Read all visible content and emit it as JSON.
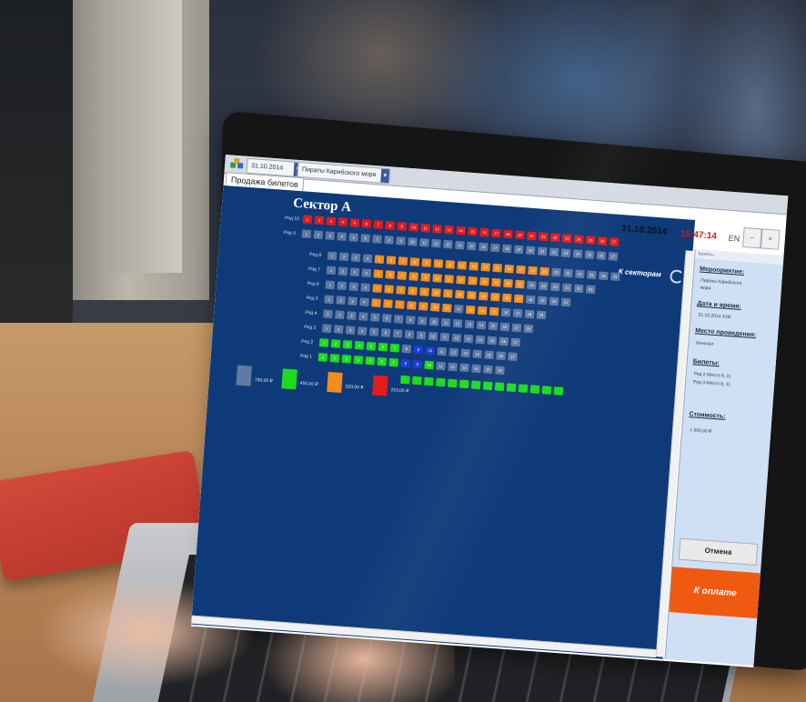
{
  "browser": {
    "date_tab": "31.10.2014",
    "event_tab": "Пираты Карибского моря",
    "page_tab": "Продажа билетов"
  },
  "header": {
    "sector_title": "Сектор А",
    "date": "31.10.2014",
    "time": "15:47:14",
    "lang": "EN"
  },
  "hall": {
    "to_sectors": "К секторам",
    "rows": [
      {
        "label": "Ряд 10",
        "seats": [
          "r",
          "r",
          "r",
          "r",
          "r",
          "r",
          "r",
          "r",
          "r",
          "r",
          "r",
          "r",
          "r",
          "r",
          "r",
          "r",
          "r",
          "r",
          "r",
          "r",
          "r",
          "r",
          "r",
          "r",
          "r",
          "r",
          "r"
        ]
      },
      {
        "label": "Ряд 9",
        "seats": [
          "g",
          "g",
          "g",
          "g",
          "g",
          "g",
          "g",
          "g",
          "g",
          "g",
          "g",
          "g",
          "g",
          "g",
          "g",
          "g",
          "g",
          "g",
          "g",
          "g",
          "g",
          "g",
          "g",
          "g",
          "g",
          "g",
          "g"
        ]
      },
      {
        "label": "Ряд 8",
        "seats": [
          "g",
          "g",
          "g",
          "g",
          "o",
          "o",
          "o",
          "o",
          "o",
          "o",
          "o",
          "o",
          "o",
          "o",
          "o",
          "o",
          "o",
          "o",
          "o",
          "g",
          "g",
          "g",
          "g",
          "g",
          "g"
        ]
      },
      {
        "label": "Ряд 7",
        "seats": [
          "g",
          "g",
          "g",
          "g",
          "o",
          "o",
          "o",
          "o",
          "o",
          "o",
          "o",
          "o",
          "o",
          "o",
          "o",
          "o",
          "o",
          "g",
          "g",
          "g",
          "g",
          "g",
          "g"
        ]
      },
      {
        "label": "Ряд 6",
        "seats": [
          "g",
          "g",
          "g",
          "g",
          "o",
          "o",
          "o",
          "o",
          "o",
          "o",
          "o",
          "o",
          "o",
          "o",
          "o",
          "o",
          "o",
          "g",
          "g",
          "g",
          "g"
        ]
      },
      {
        "label": "Ряд 5",
        "seats": [
          "g",
          "g",
          "g",
          "g",
          "o",
          "o",
          "o",
          "o",
          "o",
          "o",
          "o",
          "g",
          "o",
          "o",
          "o",
          "g",
          "g",
          "g",
          "g"
        ]
      },
      {
        "label": "Ряд 4",
        "seats": [
          "g",
          "g",
          "g",
          "g",
          "g",
          "g",
          "g",
          "g",
          "g",
          "g",
          "g",
          "g",
          "g",
          "g",
          "g",
          "g",
          "g",
          "g"
        ]
      },
      {
        "label": "Ряд 3",
        "seats": [
          "g",
          "g",
          "g",
          "g",
          "g",
          "g",
          "g",
          "g",
          "g",
          "g",
          "g",
          "g",
          "g",
          "g",
          "g",
          "g",
          "g"
        ]
      },
      {
        "label": "Ряд 2",
        "seats": [
          "G",
          "G",
          "G",
          "G",
          "G",
          "G",
          "G",
          "g",
          "b",
          "b",
          "g",
          "g",
          "g",
          "g",
          "g",
          "g",
          "g"
        ]
      },
      {
        "label": "Ряд 1",
        "seats": [
          "G",
          "G",
          "G",
          "G",
          "G",
          "G",
          "G",
          "b",
          "b",
          "G",
          "g",
          "g",
          "g",
          "g",
          "g",
          "g"
        ]
      }
    ],
    "extra_row": [
      "G",
      "G",
      "G",
      "G",
      "G",
      "G",
      "G",
      "G",
      "G",
      "G",
      "G",
      "G",
      "G",
      "G"
    ],
    "legend": [
      {
        "color": "#5f7aa2",
        "label": "760,00 ₽"
      },
      {
        "color": "#1ddc1d",
        "label": "450,00 ₽"
      },
      {
        "color": "#f48d1b",
        "label": "520,00 ₽"
      },
      {
        "color": "#e21c1c",
        "label": "210,00 ₽"
      }
    ]
  },
  "info": {
    "head": "Билеты",
    "event_label": "Мероприятие:",
    "event_value_1": "Пираты Карибского",
    "event_value_2": "моря",
    "datetime_label": "Дата и время:",
    "datetime_value": "31.10.2014 9:00",
    "place_label": "Место проведения:",
    "place_value": "Кинозал",
    "tickets_label": "Билеты:",
    "ticket_1": "Ряд 2 Место 8, 11",
    "ticket_2": "Ряд 3 Место 8, 11",
    "cost_label": "Стоимость:",
    "cost_value": "1 900,00 ₽",
    "cancel": "Отмена",
    "pay": "К оплате"
  }
}
